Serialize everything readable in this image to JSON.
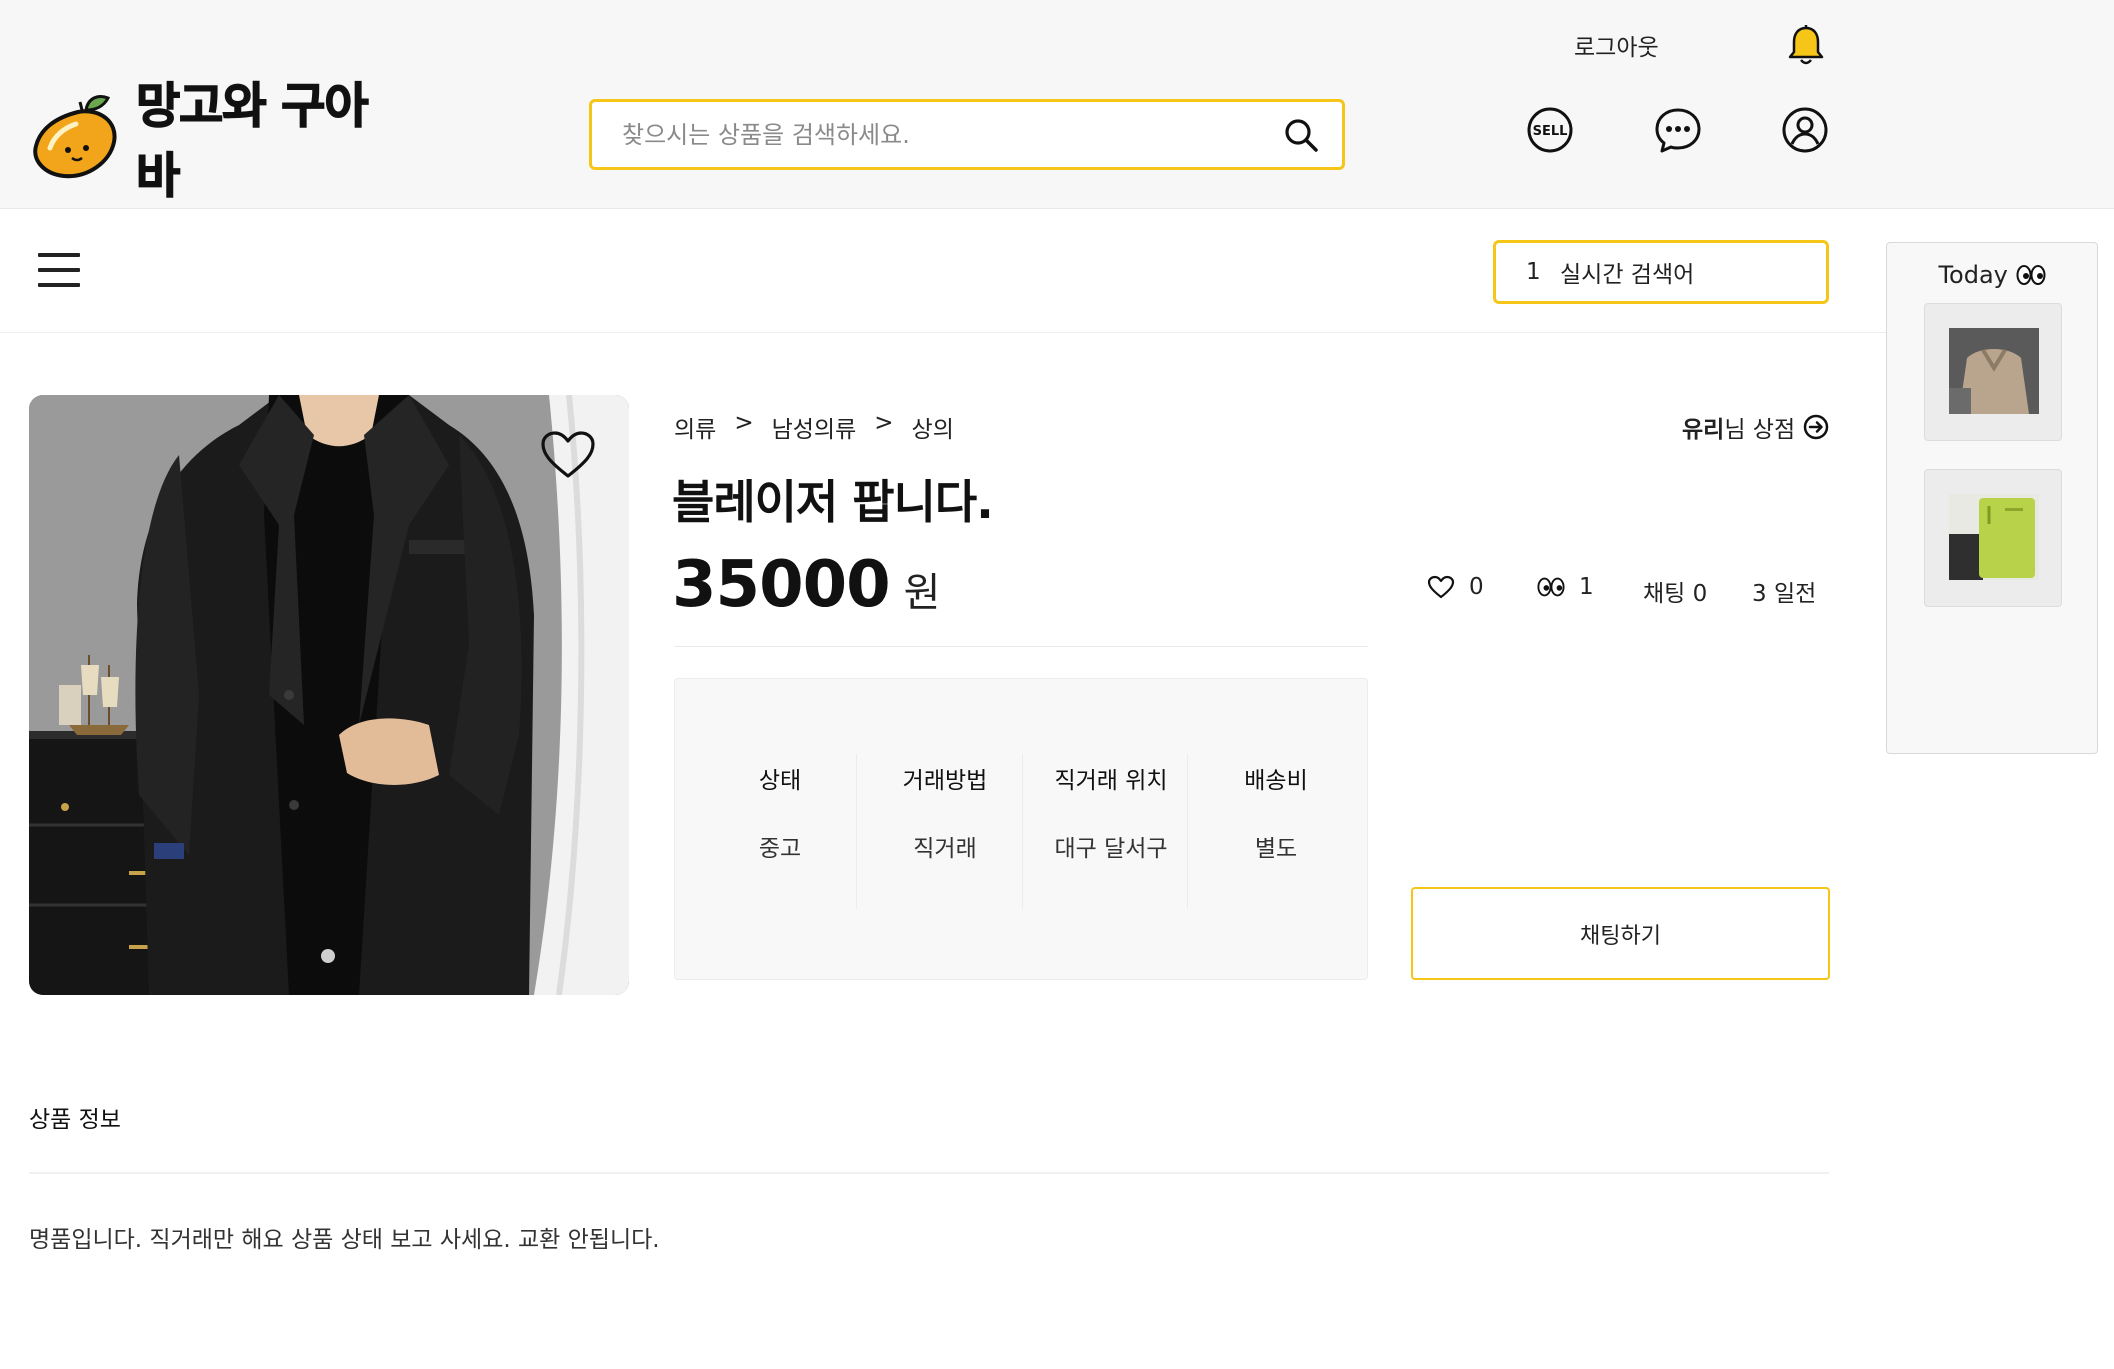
{
  "header": {
    "logout_label": "로그아웃",
    "logo_text": "망고와 구아바",
    "search_placeholder": "찾으시는 상품을 검색하세요.",
    "icons": [
      "bell-icon",
      "sell-icon",
      "chat-bubble-icon",
      "user-profile-icon",
      "search-icon"
    ],
    "sell_badge_text": "SELL"
  },
  "subnav": {
    "realtime_rank": "1",
    "realtime_label": "실시간 검색어"
  },
  "today": {
    "title": "Today"
  },
  "product": {
    "breadcrumb": [
      "의류",
      "남성의류",
      "상의"
    ],
    "breadcrumb_sep": ">",
    "shop_owner": "유리",
    "shop_suffix": "님 상점",
    "title": "블레이저 팝니다.",
    "price": "35000",
    "currency": "원",
    "likes": "0",
    "views": "1",
    "chats_label": "채팅 0",
    "posted": "3 일전",
    "info": [
      {
        "key": "상태",
        "value": "중고"
      },
      {
        "key": "거래방법",
        "value": "직거래"
      },
      {
        "key": "직거래 위치",
        "value": "대구 달서구"
      },
      {
        "key": "배송비",
        "value": "별도"
      }
    ],
    "chat_button": "채팅하기",
    "section_title": "상품 정보",
    "description": "명품입니다. 직거래만 해요 상품 상태 보고 사세요. 교환 안됩니다."
  },
  "colors": {
    "accent": "#f5c518",
    "header_bg": "#f7f7f7"
  }
}
